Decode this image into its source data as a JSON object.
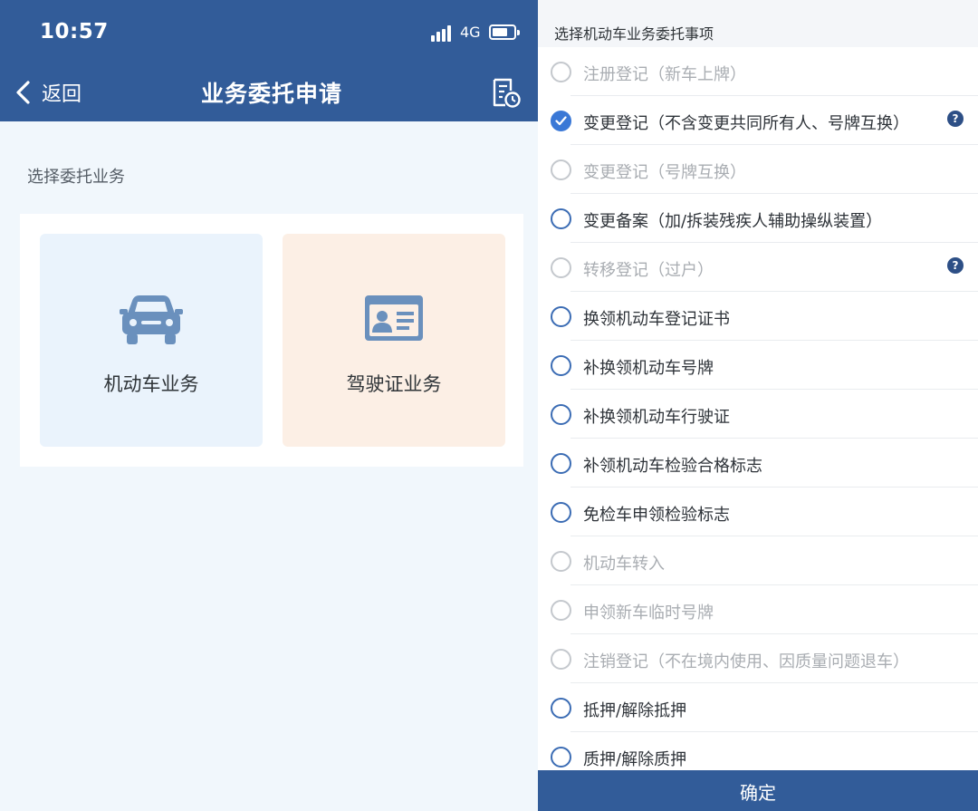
{
  "status_bar": {
    "time": "10:57",
    "network": "4G"
  },
  "header": {
    "back_label": "返回",
    "title": "业务委托申请"
  },
  "main": {
    "section_label": "选择委托业务",
    "cards": [
      {
        "label": "机动车业务",
        "icon": "car-icon"
      },
      {
        "label": "驾驶证业务",
        "icon": "id-card-icon"
      }
    ]
  },
  "sheet": {
    "title": "选择机动车业务委托事项",
    "options": [
      {
        "label": "注册登记（新车上牌）",
        "state": "disabled"
      },
      {
        "label": "变更登记（不含变更共同所有人、号牌互换）",
        "state": "checked",
        "help": "?"
      },
      {
        "label": "变更登记（号牌互换）",
        "state": "disabled"
      },
      {
        "label": "变更备案（加/拆装残疾人辅助操纵装置）",
        "state": "enabled"
      },
      {
        "label": "转移登记（过户）",
        "state": "disabled",
        "help": "?"
      },
      {
        "label": "换领机动车登记证书",
        "state": "enabled"
      },
      {
        "label": "补换领机动车号牌",
        "state": "enabled"
      },
      {
        "label": "补换领机动车行驶证",
        "state": "enabled"
      },
      {
        "label": "补领机动车检验合格标志",
        "state": "enabled"
      },
      {
        "label": "免检车申领检验标志",
        "state": "enabled"
      },
      {
        "label": "机动车转入",
        "state": "disabled"
      },
      {
        "label": "申领新车临时号牌",
        "state": "disabled"
      },
      {
        "label": "注销登记（不在境内使用、因质量问题退车）",
        "state": "disabled"
      },
      {
        "label": "抵押/解除抵押",
        "state": "enabled"
      },
      {
        "label": "质押/解除质押",
        "state": "enabled"
      }
    ],
    "confirm_label": "确定"
  },
  "colors": {
    "primary": "#325c99",
    "checked": "#3a78d6",
    "vehicle_card_bg": "#eaf3fc",
    "license_card_bg": "#fcefe5"
  }
}
